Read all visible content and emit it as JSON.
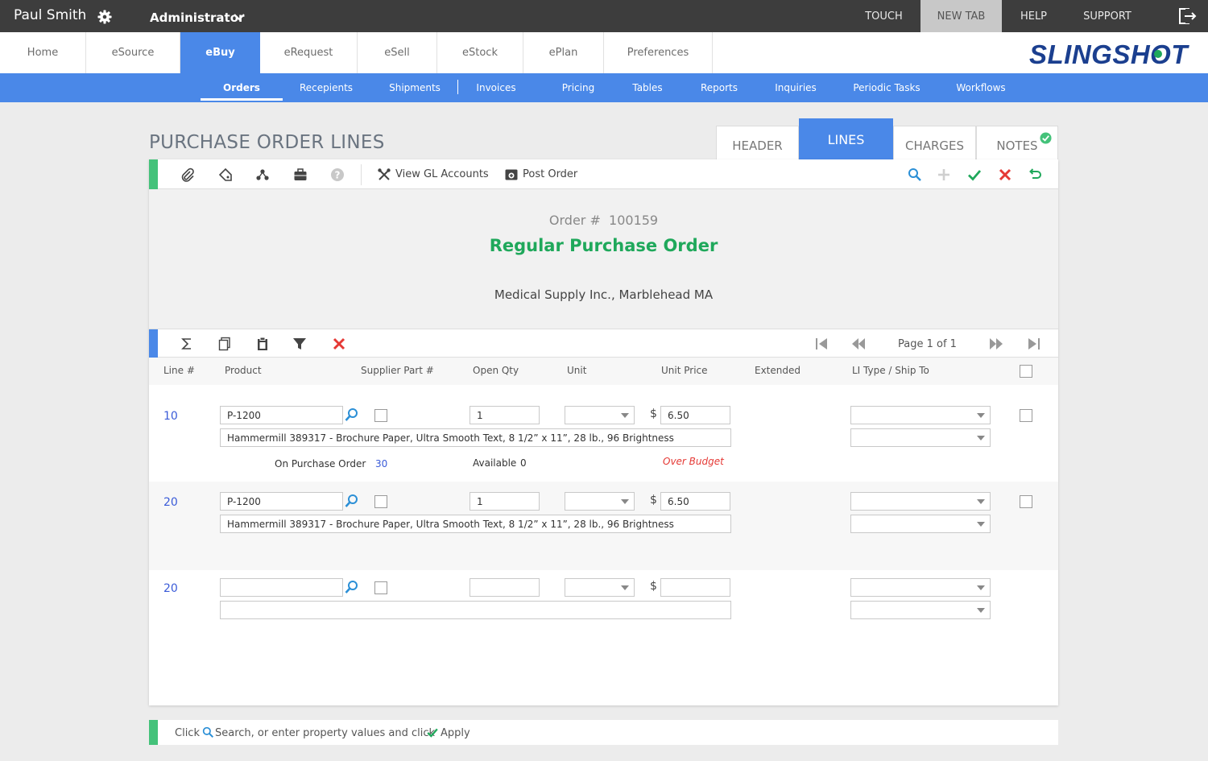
{
  "topbar": {
    "user": "Paul Smith",
    "role": "Administrator",
    "nav": [
      "TOUCH",
      "NEW TAB",
      "HELP",
      "SUPPORT"
    ]
  },
  "modules": [
    "Home",
    "eSource",
    "eBuy",
    "eRequest",
    "eSell",
    "eStock",
    "ePlan",
    "Preferences"
  ],
  "logo_text": "SLINGSHOT",
  "subnav": [
    "Orders",
    "Recepients",
    "Shipments",
    "Invoices",
    "Pricing",
    "Tables",
    "Reports",
    "Inquiries",
    "Periodic Tasks",
    "Workflows"
  ],
  "page_title": "PURCHASE ORDER LINES",
  "section_tabs": [
    "HEADER",
    "LINES",
    "CHARGES",
    "NOTES"
  ],
  "toolbar": {
    "view_gl": "View GL Accounts",
    "post_order": "Post Order"
  },
  "order": {
    "label": "Order #",
    "number": "100159",
    "type": "Regular Purchase Order",
    "supplier": "Medical Supply Inc., Marblehead MA"
  },
  "pager": {
    "text": "Page 1 of 1"
  },
  "columns": [
    "Line #",
    "Product",
    "Supplier Part #",
    "Open Qty",
    "Unit",
    "Unit Price",
    "Extended",
    "LI Type / Ship To"
  ],
  "lines": [
    {
      "line_no": "10",
      "product": "P-1200",
      "open_qty": "1",
      "unit_price": "6.50",
      "description": "Hammermill 389317 - Brochure Paper, Ultra Smooth Text, 8 1/2” x 11”, 28 lb., 96 Brightness",
      "on_po_label": "On Purchase Order",
      "on_po_value": "30",
      "available_label": "Available",
      "available_value": "0",
      "warning": "Over Budget"
    },
    {
      "line_no": "20",
      "product": "P-1200",
      "open_qty": "1",
      "unit_price": "6.50",
      "description": "Hammermill 389317 - Brochure Paper, Ultra Smooth Text, 8 1/2” x 11”, 28 lb., 96 Brightness"
    },
    {
      "line_no": "20",
      "product": "",
      "open_qty": "",
      "unit_price": "",
      "description": ""
    }
  ],
  "currency_symbol": "$",
  "hint": {
    "click": "Click",
    "search_text": "Search, or enter property values and click",
    "apply": "Apply"
  },
  "colors": {
    "accent_blue": "#4a88e8",
    "success_green": "#1fa85b",
    "danger_red": "#e53935",
    "topbar": "#3d3d3d"
  }
}
